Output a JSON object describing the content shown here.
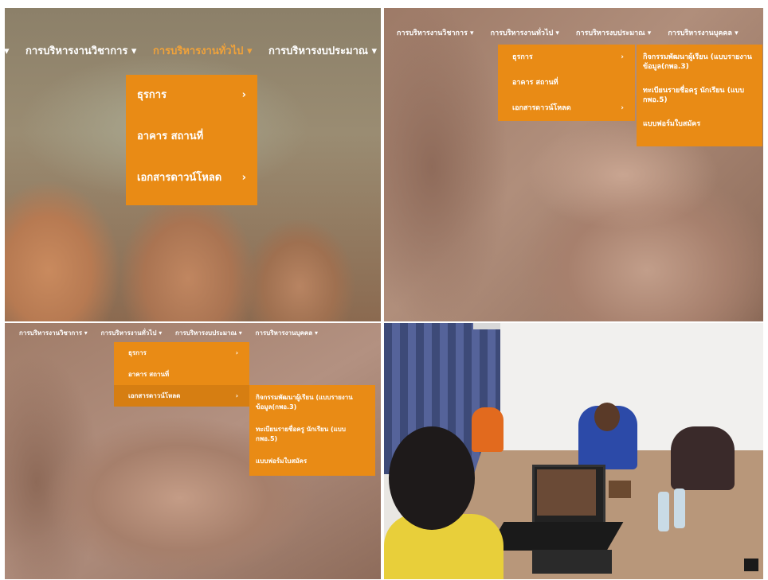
{
  "nav": {
    "items": [
      "การบริหารงานวิชาการ",
      "การบริหารงานทั่วไป",
      "การบริหารงบประมาณ",
      "การบริหารงานบุคคล"
    ],
    "chevron": "▾",
    "lead_chevron": "."
  },
  "submenu": {
    "items": [
      "ธุรการ",
      "อาคาร สถานที่",
      "เอกสารดาวน์โหลด"
    ],
    "arrow": "›"
  },
  "downloads": {
    "items": [
      "กิจกรรมพัฒนาผู้เรียน (แบบรายงานข้อมูล(กพอ.3)",
      "ทะเบียนรายชื่อครู นักเรียน (แบบ กพอ.5)",
      "แบบฟอร์มใบสมัคร"
    ]
  },
  "colors": {
    "menu_bg": "#e98b15",
    "menu_selected": "#d67e12",
    "nav_active": "#f0a23a"
  },
  "icons": [
    "chevron-down-icon",
    "chevron-right-icon"
  ]
}
